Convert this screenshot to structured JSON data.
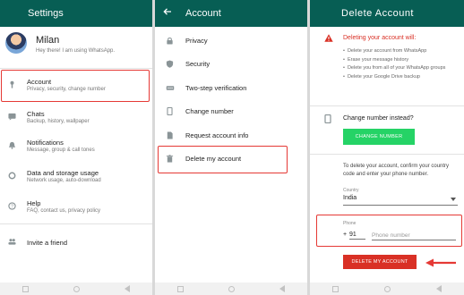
{
  "settings": {
    "title": "Settings",
    "profile": {
      "name": "Milan",
      "status": "Hey there! I am using WhatsApp."
    },
    "items": [
      {
        "icon": "key-icon",
        "title": "Account",
        "subtitle": "Privacy, security, change number"
      },
      {
        "icon": "chat-icon",
        "title": "Chats",
        "subtitle": "Backup, history, wallpaper"
      },
      {
        "icon": "bell-icon",
        "title": "Notifications",
        "subtitle": "Message, group & call tones"
      },
      {
        "icon": "data-usage-icon",
        "title": "Data and storage usage",
        "subtitle": "Network usage, auto-download"
      },
      {
        "icon": "help-icon",
        "title": "Help",
        "subtitle": "FAQ, contact us, privacy policy"
      },
      {
        "icon": "people-icon",
        "title": "Invite a friend",
        "subtitle": ""
      }
    ]
  },
  "account": {
    "title": "Account",
    "items": [
      {
        "icon": "lock-icon",
        "label": "Privacy"
      },
      {
        "icon": "shield-icon",
        "label": "Security"
      },
      {
        "icon": "dots-icon",
        "label": "Two-step verification"
      },
      {
        "icon": "phone-swap-icon",
        "label": "Change number"
      },
      {
        "icon": "document-icon",
        "label": "Request account info"
      },
      {
        "icon": "trash-icon",
        "label": "Delete my account"
      }
    ]
  },
  "delete": {
    "title": "Delete Account",
    "warning_title": "Deleting your account will:",
    "bullets": [
      "Delete your account from WhatsApp",
      "Erase your message history",
      "Delete you from all of your WhatsApp groups",
      "Delete your Google Drive backup"
    ],
    "change_title": "Change number instead?",
    "change_button": "CHANGE NUMBER",
    "confirm_text": "To delete your account, confirm your country code and enter your phone number.",
    "country_label": "Country",
    "country_value": "India",
    "phone_label": "Phone",
    "plus": "+",
    "country_code": "91",
    "phone_placeholder": "Phone number",
    "delete_button": "DELETE MY ACCOUNT"
  },
  "colors": {
    "appbar": "#075e54",
    "accent_green": "#25d366",
    "danger": "#d93025",
    "highlight": "#e53935"
  }
}
